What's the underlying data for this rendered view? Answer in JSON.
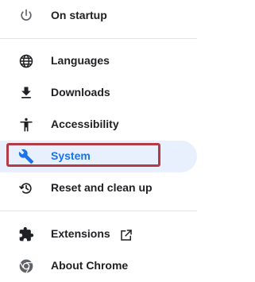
{
  "settings_nav": {
    "items": [
      {
        "label": "On startup",
        "icon": "power-icon"
      },
      {
        "label": "Languages",
        "icon": "globe-icon"
      },
      {
        "label": "Downloads",
        "icon": "download-icon"
      },
      {
        "label": "Accessibility",
        "icon": "accessibility-icon"
      },
      {
        "label": "System",
        "icon": "wrench-icon",
        "selected": true
      },
      {
        "label": "Reset and clean up",
        "icon": "restore-icon"
      },
      {
        "label": "Extensions",
        "icon": "puzzle-icon",
        "external": true
      },
      {
        "label": "About Chrome",
        "icon": "chrome-icon"
      }
    ]
  },
  "colors": {
    "selected_bg": "#e8f0fe",
    "selected_text": "#1a73e8",
    "highlight_border": "#b33b44",
    "icon": "#5f6368"
  }
}
